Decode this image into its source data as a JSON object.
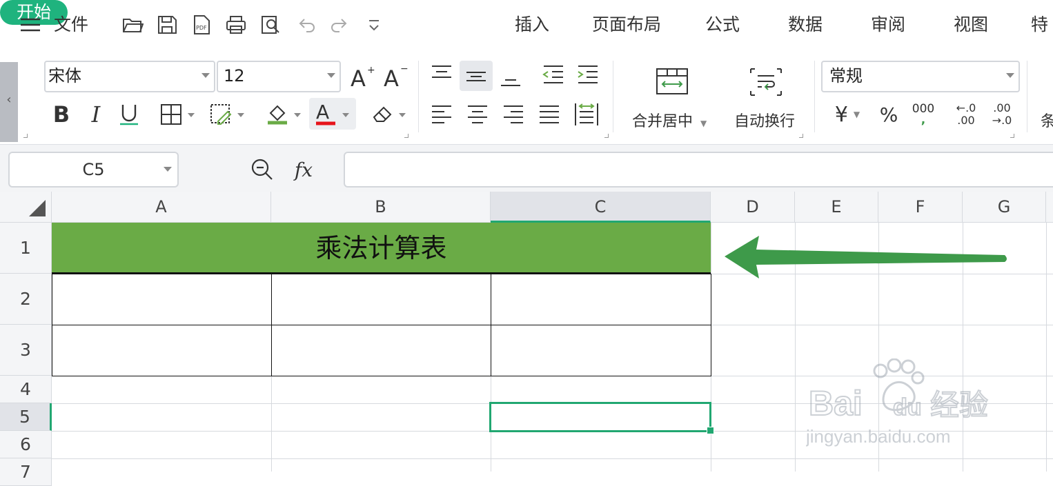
{
  "menubar": {
    "file_label": "文件",
    "tabs": [
      "开始",
      "插入",
      "页面布局",
      "公式",
      "数据",
      "审阅",
      "视图",
      "特"
    ]
  },
  "ribbon": {
    "font_name": "宋体",
    "font_size": "12",
    "merge_center_label": "合并居中",
    "wrap_text_label": "自动换行",
    "number_format": "常规",
    "currency_symbol": "¥",
    "percent_symbol": "%",
    "thousands_top": "000",
    "thousands_bottom": ",",
    "inc_decimal_top": "←.0",
    "inc_decimal_bottom": ".00",
    "dec_decimal_top": ".00",
    "dec_decimal_bottom": "→.0",
    "cut_label": "条"
  },
  "formula_bar": {
    "name_box": "C5",
    "fx_label": "fx",
    "formula": ""
  },
  "grid": {
    "columns": [
      "A",
      "B",
      "C",
      "D",
      "E",
      "F",
      "G"
    ],
    "rows": [
      "1",
      "2",
      "3",
      "4",
      "5",
      "6",
      "7"
    ],
    "title_cell": "乘法计算表",
    "selected_cell": "C5"
  },
  "colors": {
    "accent": "#1fb37e",
    "title_fill": "#6aab46",
    "arrow": "#3e9a4a",
    "selection": "#21a771",
    "fill_underline": "#6aab46",
    "font_underline": "#e6141b"
  },
  "watermark": {
    "brand": "Bai du 经验",
    "url": "jingyan.baidu.com"
  }
}
